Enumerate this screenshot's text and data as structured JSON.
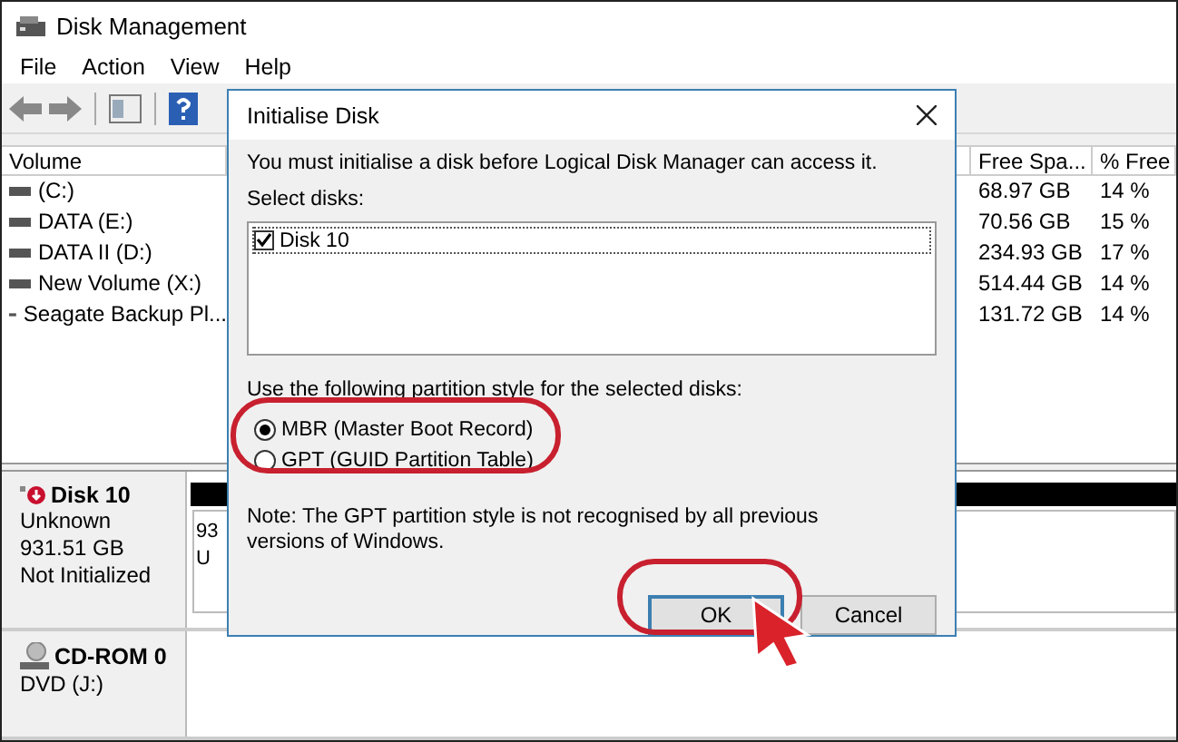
{
  "window": {
    "title": "Disk Management"
  },
  "menu": [
    "File",
    "Action",
    "View",
    "Help"
  ],
  "volume_table": {
    "columns": [
      "Volume",
      "Free Spa...",
      "% Free"
    ],
    "rows": [
      {
        "volume": "(C:)",
        "free_space": "68.97 GB",
        "percent_free": "14 %"
      },
      {
        "volume": "DATA (E:)",
        "free_space": "70.56 GB",
        "percent_free": "15 %"
      },
      {
        "volume": "DATA II (D:)",
        "free_space": "234.93 GB",
        "percent_free": "17 %"
      },
      {
        "volume": "New Volume (X:)",
        "free_space": "514.44 GB",
        "percent_free": "14 %"
      },
      {
        "volume": "Seagate Backup Pl...",
        "free_space": "131.72 GB",
        "percent_free": "14 %"
      }
    ]
  },
  "disks": [
    {
      "name": "Disk 10",
      "kind": "error",
      "lines": [
        "Unknown",
        "931.51 GB",
        "Not Initialized"
      ],
      "partition": [
        "93",
        "U"
      ]
    },
    {
      "name": "CD-ROM 0",
      "kind": "cdrom",
      "lines": [
        "DVD (J:)"
      ]
    }
  ],
  "dialog": {
    "title": "Initialise Disk",
    "message": "You must initialise a disk before Logical Disk Manager can access it.",
    "select_label": "Select disks:",
    "disks": [
      {
        "label": "Disk 10",
        "checked": true
      }
    ],
    "style_label": "Use the following partition style for the selected disks:",
    "styles": [
      {
        "label": "MBR (Master Boot Record)",
        "selected": true
      },
      {
        "label": "GPT (GUID Partition Table)",
        "selected": false
      }
    ],
    "note": "Note: The GPT partition style is not recognised by all previous versions of Windows.",
    "buttons": [
      {
        "label": "OK",
        "default": true
      },
      {
        "label": "Cancel",
        "default": false
      }
    ]
  }
}
